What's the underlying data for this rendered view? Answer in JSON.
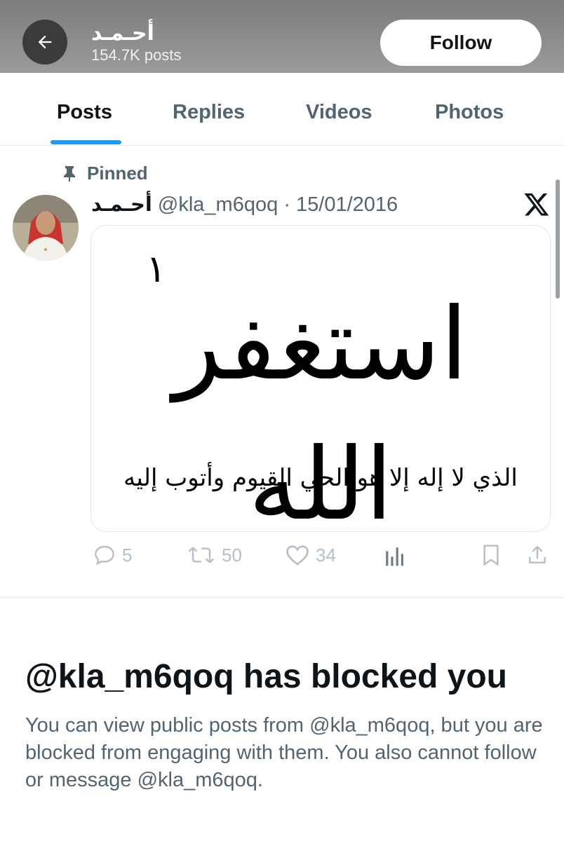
{
  "header": {
    "name": "أحـمـد",
    "posts_count": "154.7K posts",
    "follow_label": "Follow"
  },
  "tabs": [
    {
      "label": "Posts",
      "active": true
    },
    {
      "label": "Replies",
      "active": false
    },
    {
      "label": "Videos",
      "active": false
    },
    {
      "label": "Photos",
      "active": false
    }
  ],
  "pinned_post": {
    "pinned_label": "Pinned",
    "author_name": "أحـمـد",
    "handle": "@kla_m6qoq",
    "separator": "·",
    "date": "15/01/2016",
    "media": {
      "numeral": "١",
      "main_text": "استغفر الله",
      "sub_text": "الذي لا إله إلا هو الحي القيوم وأتوب إليه"
    },
    "stats": {
      "replies": "5",
      "reposts": "50",
      "likes": "34"
    }
  },
  "blocked": {
    "title": "@kla_m6qoq has blocked you",
    "body": "You can view public posts from @kla_m6qoq, but you are blocked from engaging with them. You also cannot follow or message @kla_m6qoq."
  },
  "colors": {
    "accent": "#1d9bf0",
    "text_primary": "#0f1419",
    "text_secondary": "#536471",
    "icon_muted": "#b6bfc7"
  }
}
